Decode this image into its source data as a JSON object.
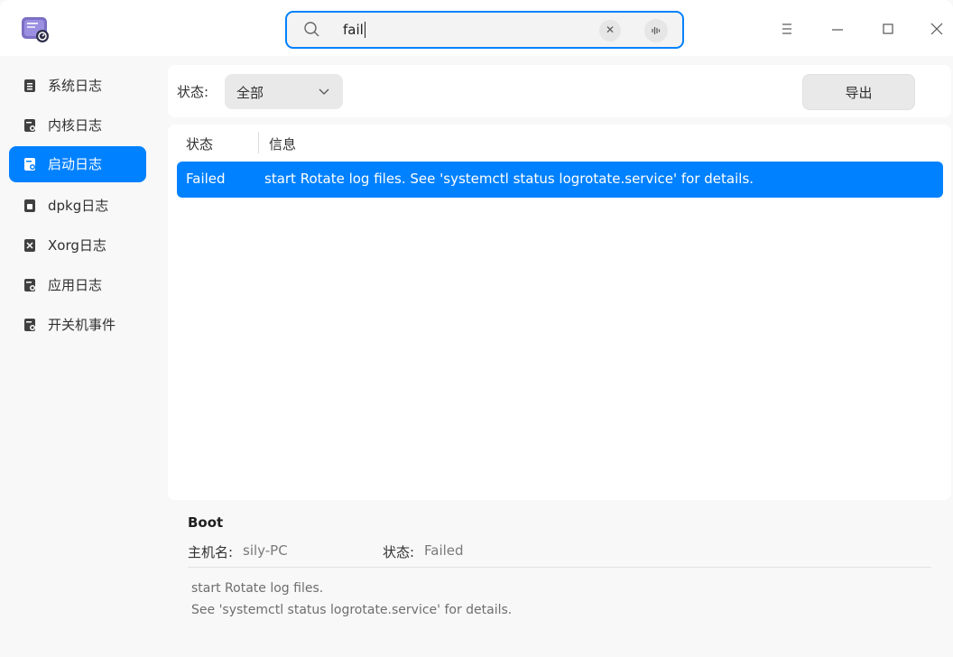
{
  "titlebar": {
    "search_value": "fail",
    "menu_icon": "hamburger-menu-icon",
    "minimize_icon": "minimize-icon",
    "maximize_icon": "maximize-icon",
    "close_icon": "close-icon"
  },
  "sidebar": {
    "items": [
      {
        "label": "系统日志",
        "icon": "document-icon"
      },
      {
        "label": "内核日志",
        "icon": "kernel-log-icon"
      },
      {
        "label": "启动日志",
        "icon": "boot-log-icon",
        "active": true
      },
      {
        "label": "dpkg日志",
        "icon": "package-log-icon"
      },
      {
        "label": "Xorg日志",
        "icon": "xorg-log-icon"
      },
      {
        "label": "应用日志",
        "icon": "app-log-icon"
      },
      {
        "label": "开关机事件",
        "icon": "power-event-icon"
      }
    ]
  },
  "filter": {
    "status_label": "状态:",
    "status_value": "全部",
    "export_label": "导出"
  },
  "table": {
    "columns": [
      "状态",
      "信息"
    ],
    "rows": [
      {
        "status": "Failed",
        "info": "start Rotate log files. See 'systemctl status logrotate.service' for details.",
        "selected": true
      }
    ]
  },
  "detail": {
    "title": "Boot",
    "host_label": "主机名:",
    "host_value": "sily-PC",
    "status_label": "状态:",
    "status_value": "Failed",
    "message_line1": "start Rotate log files.",
    "message_line2": "See 'systemctl status logrotate.service' for details."
  },
  "colors": {
    "accent": "#0081ff",
    "background": "#f8f8f8",
    "panel": "#ffffff"
  }
}
